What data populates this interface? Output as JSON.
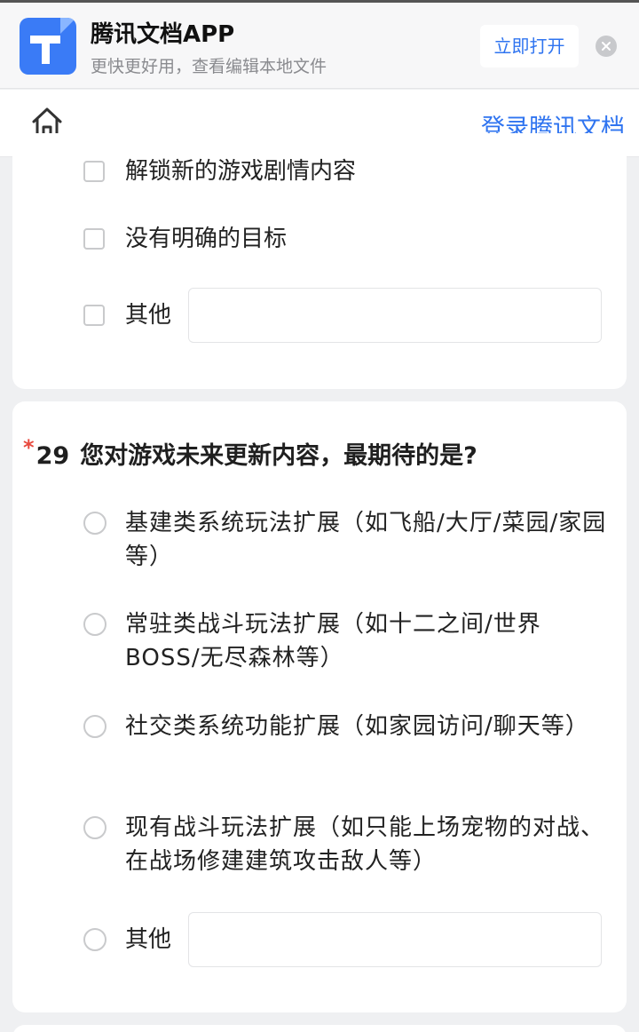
{
  "banner": {
    "app_name": "腾讯文档APP",
    "subtitle": "更快更好用，查看编辑本地文件",
    "open_label": "立即打开",
    "close_icon": "close-icon"
  },
  "nav": {
    "home_icon": "home-icon",
    "login_label": "登录腾讯文档"
  },
  "prev_question": {
    "options": [
      {
        "label": "解锁新的游戏剧情内容",
        "checked": false
      },
      {
        "label": "没有明确的目标",
        "checked": false
      },
      {
        "label": "其他",
        "checked": false,
        "has_input": true,
        "input_value": ""
      }
    ]
  },
  "q29": {
    "required_mark": "*",
    "number": "29",
    "title": "您对游戏未来更新内容，最期待的是?",
    "options": [
      {
        "label": "基建类系统玩法扩展（如飞船/大厅/菜园/家园等）",
        "selected": false
      },
      {
        "label": "常驻类战斗玩法扩展（如十二之间/世界BOSS/无尽森林等）",
        "selected": false
      },
      {
        "label": "社交类系统功能扩展（如家园访问/聊天等）",
        "selected": false
      },
      {
        "label": "现有战斗玩法扩展（如只能上场宠物的对战、在战场修建建筑攻击敌人等）",
        "selected": false
      },
      {
        "label": "其他",
        "selected": false,
        "has_input": true,
        "input_value": ""
      }
    ]
  },
  "colors": {
    "accent": "#2f74f0",
    "required": "#e84a3f",
    "page_bg": "#eff0f2"
  }
}
